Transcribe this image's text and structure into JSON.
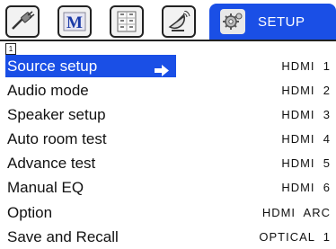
{
  "tabs": [
    {
      "icon": "plug-cable-icon"
    },
    {
      "icon": "m-logo-icon",
      "text": "M"
    },
    {
      "icon": "grid-panel-icon"
    },
    {
      "icon": "satellite-dish-icon"
    }
  ],
  "active_tab": {
    "icon": "gear-icon",
    "label": "SETUP"
  },
  "page_marker": "1",
  "menu": [
    {
      "label": "Source setup",
      "value": "HDMI  1"
    },
    {
      "label": "Audio mode",
      "value": "HDMI  2"
    },
    {
      "label": "Speaker setup",
      "value": "HDMI  3"
    },
    {
      "label": "Auto room test",
      "value": "HDMI  4"
    },
    {
      "label": "Advance test",
      "value": "HDMI  5"
    },
    {
      "label": "Manual EQ",
      "value": "HDMI  6"
    },
    {
      "label": "Option",
      "value": "HDMI  ARC"
    },
    {
      "label": "Save and Recall",
      "value": "OPTICAL  1"
    }
  ],
  "colors": {
    "accent": "#1a4fe6"
  }
}
